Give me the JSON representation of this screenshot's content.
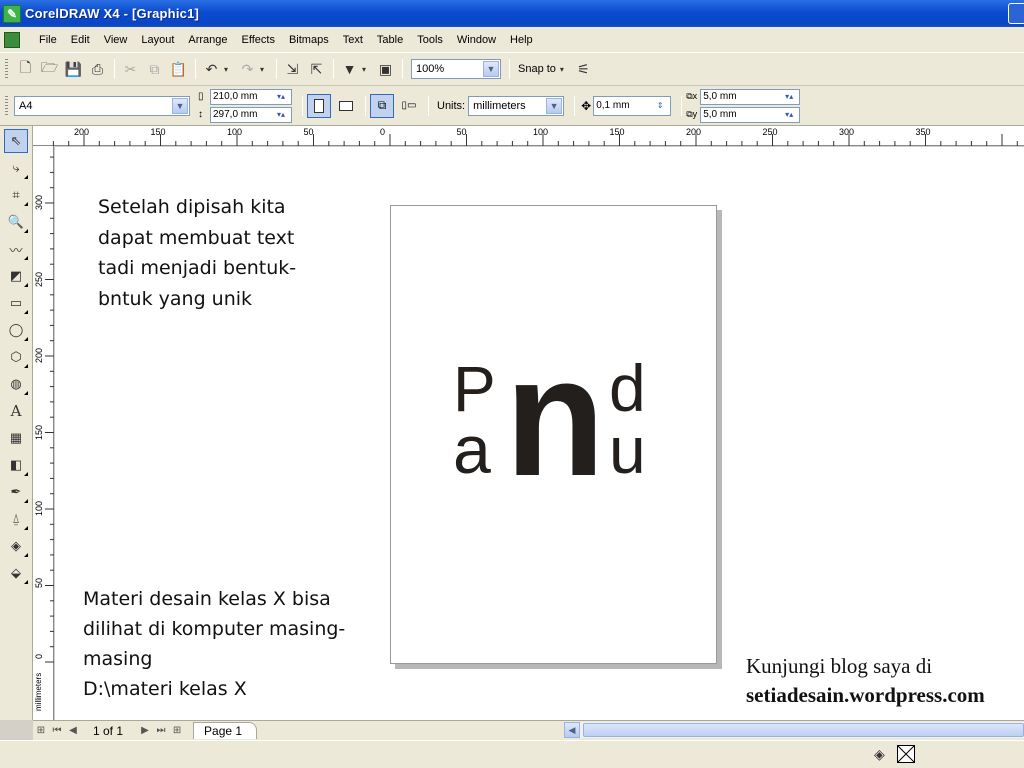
{
  "window": {
    "title": "CorelDRAW X4 - [Graphic1]"
  },
  "menu": [
    {
      "label": "File"
    },
    {
      "label": "Edit"
    },
    {
      "label": "View"
    },
    {
      "label": "Layout"
    },
    {
      "label": "Arrange"
    },
    {
      "label": "Effects"
    },
    {
      "label": "Bitmaps"
    },
    {
      "label": "Text"
    },
    {
      "label": "Table"
    },
    {
      "label": "Tools"
    },
    {
      "label": "Window"
    },
    {
      "label": "Help"
    }
  ],
  "toolbar": {
    "zoom": "100%",
    "snap_to": "Snap to"
  },
  "property_bar": {
    "paper": "A4",
    "width": "210,0 mm",
    "height": "297,0 mm",
    "units_label": "Units:",
    "units_value": "millimeters",
    "nudge": "0,1 mm",
    "duplicate_x": "5,0 mm",
    "duplicate_y": "5,0 mm"
  },
  "ruler": {
    "h_labels": [
      "200",
      "150",
      "100",
      "50",
      "0",
      "50",
      "100",
      "150",
      "200",
      "250",
      "300",
      "350"
    ],
    "v_labels": [
      "300",
      "250",
      "200",
      "150",
      "100",
      "50",
      "0"
    ],
    "v_unit": "millimeters"
  },
  "canvas": {
    "note_top": [
      "Setelah dipisah kita",
      "dapat membuat text",
      "tadi menjadi bentuk-",
      "bntuk yang unik"
    ],
    "note_bottom": [
      "Materi desain kelas X bisa",
      "dilihat di komputer masing-",
      "masing",
      "D:\\materi kelas X"
    ],
    "logo_letters": {
      "p": "P",
      "a": "a",
      "n": "n",
      "d": "d",
      "u": "u"
    },
    "blog_line1": "Kunjungi blog saya di",
    "blog_line2": "setiadesain.wordpress.com"
  },
  "page_nav": {
    "position": "1 of 1",
    "tab": "Page 1"
  },
  "colors": {
    "titlebar": "#0b4bd0",
    "chrome": "#ece9d8",
    "selection": "#c1d2ee",
    "logo": "#221f1c"
  }
}
